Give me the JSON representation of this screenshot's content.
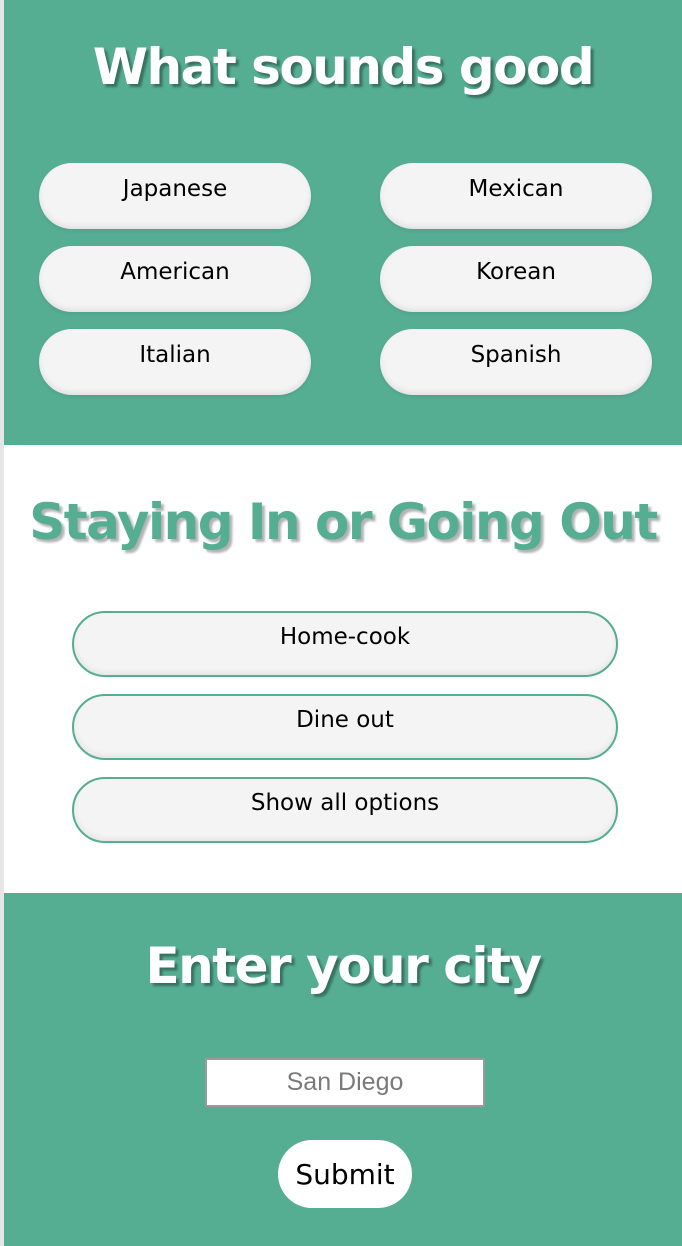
{
  "cuisine_section": {
    "title": "What sounds good",
    "options": [
      "Japanese",
      "Mexican",
      "American",
      "Korean",
      "Italian",
      "Spanish"
    ]
  },
  "mode_section": {
    "title": "Staying In or Going Out",
    "options": [
      "Home-cook",
      "Dine out",
      "Show all options"
    ]
  },
  "city_section": {
    "title": "Enter your city",
    "input_placeholder": "San Diego",
    "input_value": "",
    "submit_label": "Submit"
  },
  "colors": {
    "accent_green": "#55ad92",
    "pill_background": "#f4f4f4",
    "white": "#ffffff"
  }
}
